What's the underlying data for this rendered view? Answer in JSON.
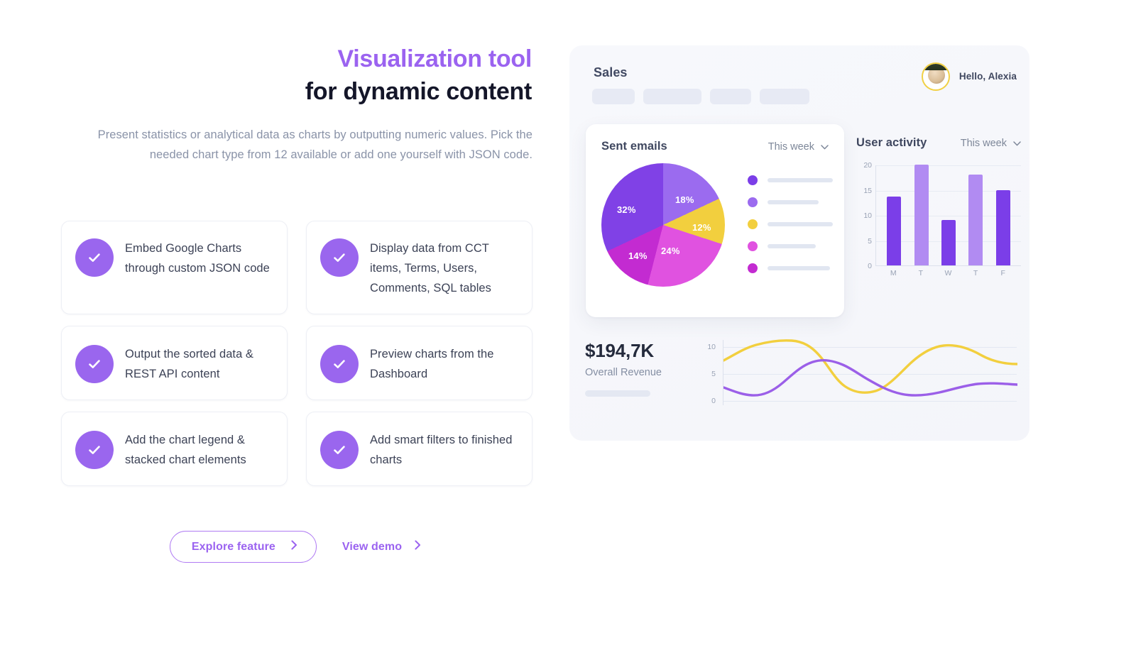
{
  "headline": {
    "line1": "Visualization tool",
    "line2": "for dynamic content"
  },
  "subcopy": "Present statistics or analytical data as charts by outputting numeric values. Pick the needed chart type from 12 available or add one yourself with JSON code.",
  "features": [
    {
      "text": "Embed Google Charts through custom JSON code"
    },
    {
      "text": "Display data from CCT items, Terms, Users, Comments, SQL tables"
    },
    {
      "text": "Output the sorted data & REST API content"
    },
    {
      "text": "Preview charts from the Dashboard"
    },
    {
      "text": "Add the chart legend & stacked chart elements"
    },
    {
      "text": "Add smart filters to finished charts"
    }
  ],
  "cta": {
    "primary_label": "Explore feature",
    "secondary_label": "View demo",
    "chevron": "›"
  },
  "colors": {
    "accent_purple": "#9B63F0",
    "check_circle": "#9A66EE",
    "headline_dark": "#141629",
    "body_gray": "#8A93A8",
    "panel_bg": "#F6F7FB",
    "yellow": "#F2CF3E",
    "placeholder_gray": "#E1E6F1"
  },
  "dashboard": {
    "title": "Sales",
    "nav_pills": 4,
    "greeting": {
      "name": "Hello, Alexia",
      "avatar": "user-photo"
    },
    "sent_emails": {
      "title": "Sent emails",
      "filter_label": "This week",
      "chevron": "⌄"
    },
    "user_activity": {
      "title": "User activity",
      "filter_label": "This week",
      "chevron": "⌄"
    },
    "revenue": {
      "amount": "$194,7K",
      "label": "Overall Revenue"
    }
  },
  "chart_data": [
    {
      "type": "pie",
      "title": "Sent emails",
      "labels": [
        "18%",
        "12%",
        "24%",
        "14%",
        "32%"
      ],
      "values": [
        18,
        12,
        24,
        14,
        32
      ],
      "colors": [
        "#9B6BEF",
        "#F2CF3E",
        "#E052E0",
        "#C32BD1",
        "#8041E6"
      ],
      "legend_position": "right",
      "legend_entries": [
        "",
        "",
        "",
        "",
        ""
      ],
      "legend_colors": [
        "#7B3EE8",
        "#9B6BEF",
        "#F2CF3E",
        "#E052E0",
        "#C32BD1"
      ]
    },
    {
      "type": "bar",
      "title": "User activity",
      "categories": [
        "M",
        "T",
        "W",
        "T",
        "F"
      ],
      "values": [
        13.6,
        20,
        9,
        18,
        15
      ],
      "bar_colors": [
        "#7B3EE8",
        "#B18BF2",
        "#7B3EE8",
        "#B18BF2",
        "#7B3EE8"
      ],
      "ylim": [
        0,
        20
      ],
      "yticks": [
        0,
        5,
        10,
        15,
        20
      ],
      "xlabel": "",
      "ylabel": "",
      "grid": true
    },
    {
      "type": "line",
      "title": "Overall Revenue",
      "ylim": [
        0,
        12
      ],
      "yticks": [
        0,
        5,
        10
      ],
      "grid": true,
      "series": [
        {
          "name": "yellow-wave",
          "color": "#F2CF3E",
          "values": [
            8.6,
            11.4,
            12.6,
            11.7,
            7.6,
            3.4,
            1.9,
            2.5,
            7.2,
            11.6,
            12.2,
            10.6,
            9.7
          ]
        },
        {
          "name": "purple-wave",
          "color": "#9B5FE8",
          "values": [
            3.2,
            1.3,
            0.8,
            2.4,
            6.0,
            8.6,
            8.7,
            5.6,
            2.1,
            1.1,
            1.7,
            2.9,
            3.3
          ]
        }
      ]
    }
  ]
}
